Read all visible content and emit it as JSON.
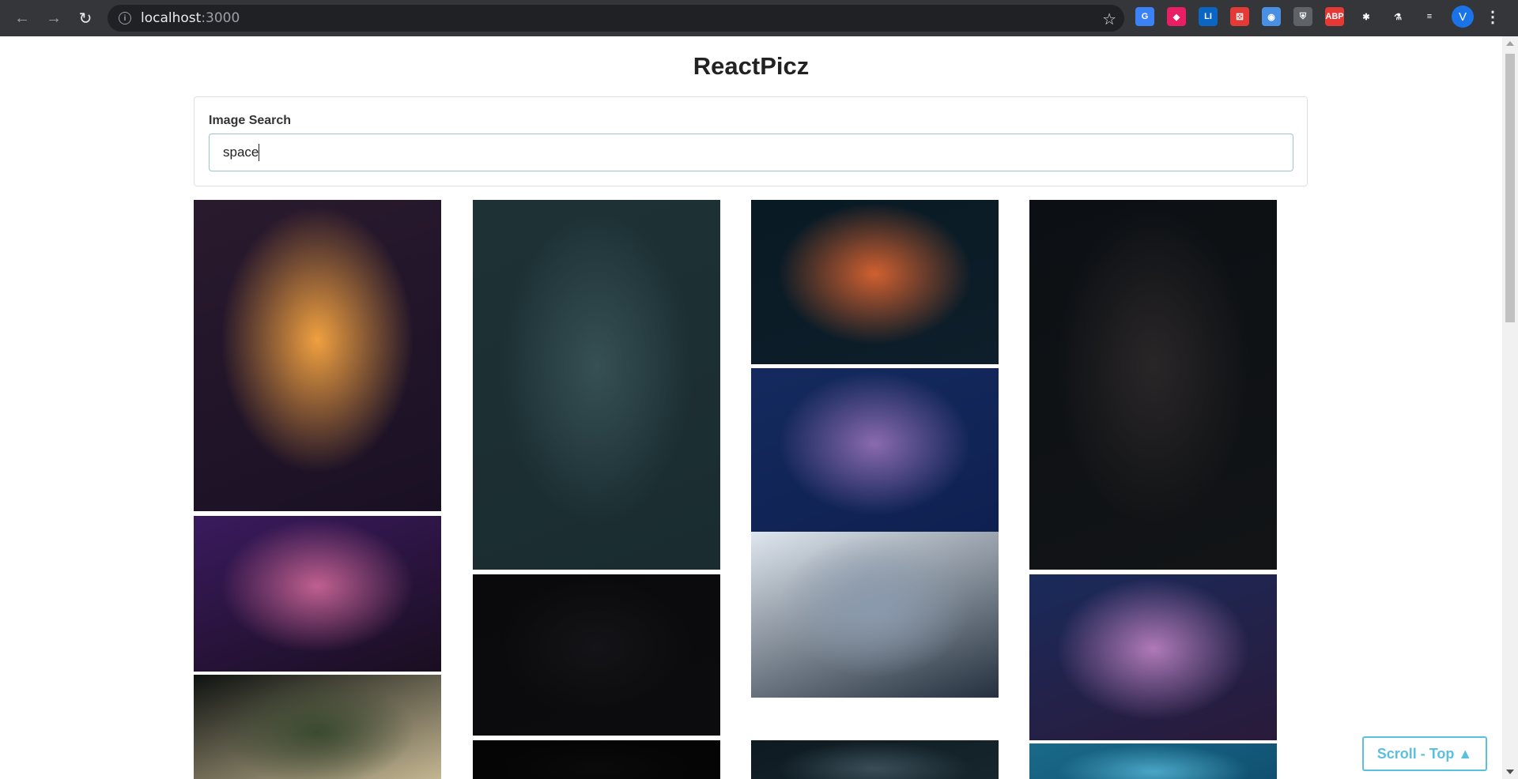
{
  "browser": {
    "url_host": "localhost",
    "url_port": ":3000",
    "extensions": [
      {
        "name": "grammarly-extension-icon",
        "text": "G",
        "color": "#3b82f6"
      },
      {
        "name": "color-picker-extension-icon",
        "text": "◆",
        "color": "#e91e63"
      },
      {
        "name": "linkedin-extension-icon",
        "text": "LI",
        "color": "#0a66c2"
      },
      {
        "name": "dice-extension-icon",
        "text": "⚄",
        "color": "#e53935"
      },
      {
        "name": "screenshot-extension-icon",
        "text": "◉",
        "color": "#4a90e2"
      },
      {
        "name": "shield-extension-icon",
        "text": "⛨",
        "color": "#5f6368"
      },
      {
        "name": "adblock-extension-icon",
        "text": "ABP",
        "color": "#e53935"
      },
      {
        "name": "puzzle-extensions-icon",
        "text": "✱",
        "color": "#35363a"
      },
      {
        "name": "labs-flask-icon",
        "text": "⚗",
        "color": "#35363a"
      },
      {
        "name": "media-queue-icon",
        "text": "≡",
        "color": "#35363a"
      }
    ],
    "profile_initial": "V"
  },
  "app": {
    "title": "ReactPicz"
  },
  "search": {
    "label": "Image Search",
    "value": "space"
  },
  "gallery": {
    "images": [
      {
        "name": "orange-nebula-swirl",
        "colors": [
          "#2a1a2e",
          "#f0a040",
          "#1a1024"
        ]
      },
      {
        "name": "purple-night-sky-horizon",
        "colors": [
          "#3a1a5e",
          "#c06090",
          "#1a0e20"
        ]
      },
      {
        "name": "andromeda-galaxy",
        "colors": [
          "#0e1210",
          "#3a4a30",
          "#d8c8a0"
        ]
      },
      {
        "name": "star-warp-burst",
        "colors": [
          "#1e3236",
          "#365054",
          "#1a2c30"
        ]
      },
      {
        "name": "dark-starfield",
        "colors": [
          "#0a0a0c",
          "#141418",
          "#0c0c0e"
        ]
      },
      {
        "name": "black-space",
        "colors": [
          "#050505",
          "#0a0a0a",
          "#050505"
        ]
      },
      {
        "name": "milky-way-core",
        "colors": [
          "#0a1a24",
          "#d06030",
          "#0e1e2a"
        ]
      },
      {
        "name": "blue-milky-way",
        "colors": [
          "#142a5e",
          "#8a6ab0",
          "#0e2050"
        ]
      },
      {
        "name": "earth-from-space-station",
        "colors": [
          "#dfe6ee",
          "#8a9aae",
          "#24303e"
        ]
      },
      {
        "name": "night-sky-teal",
        "colors": [
          "#0e1a22",
          "#3a4e58",
          "#18282e"
        ]
      },
      {
        "name": "dark-milky-way-vertical",
        "colors": [
          "#0c1014",
          "#2a2628",
          "#121416"
        ]
      },
      {
        "name": "blue-galaxy-glow",
        "colors": [
          "#1a2a5a",
          "#b07ab8",
          "#2a1a3a"
        ]
      },
      {
        "name": "blue-arc-horizon",
        "colors": [
          "#1a6a8a",
          "#4aa6c6",
          "#0e4a6a"
        ]
      }
    ]
  },
  "scroll_top": {
    "label": "Scroll - Top ▲"
  }
}
